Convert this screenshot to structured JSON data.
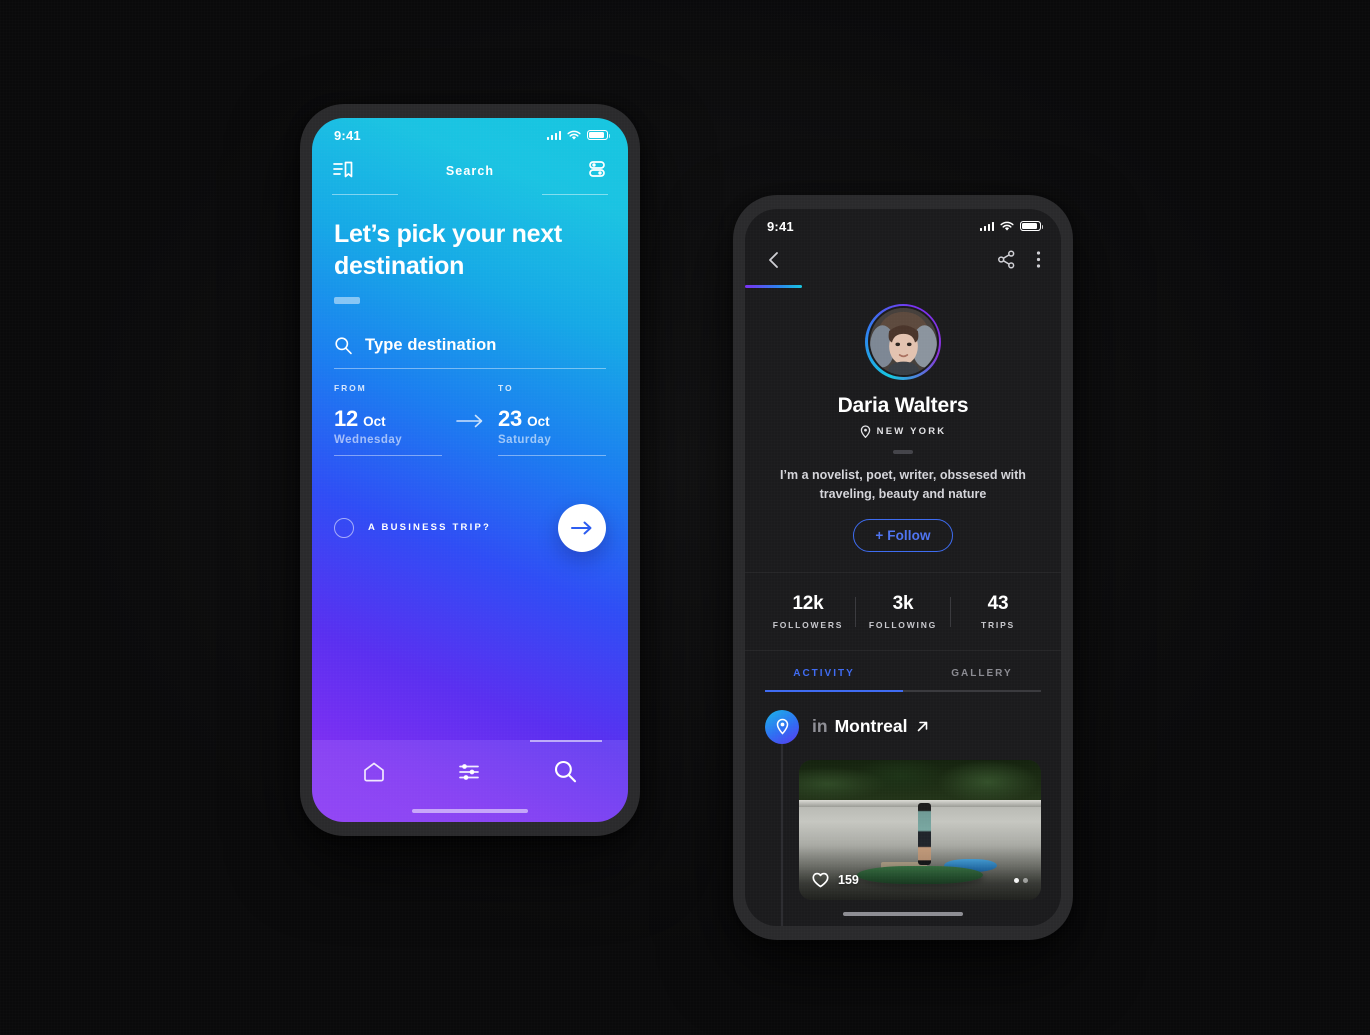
{
  "background": {
    "color": "#0b0b0c"
  },
  "left_phone": {
    "status_bar": {
      "time": "9:41",
      "signal_icon": "cellular-bars-icon",
      "wifi_icon": "wifi-icon",
      "battery_icon": "battery-icon"
    },
    "header": {
      "left_icon": "bookmark-list-icon",
      "title": "Search",
      "right_icon": "filter-toggle-icon"
    },
    "hero": {
      "title": "Let’s pick your next destination"
    },
    "search": {
      "icon": "search-icon",
      "placeholder": "Type destination",
      "value": ""
    },
    "dates": {
      "from": {
        "label": "FROM",
        "day": "12",
        "month": "Oct",
        "weekday": "Wednesday"
      },
      "arrow_icon": "arrow-right-icon",
      "to": {
        "label": "TO",
        "day": "23",
        "month": "Oct",
        "weekday": "Saturday"
      }
    },
    "business": {
      "checkbox_icon": "radio-unchecked-icon",
      "label": "A BUSINESS TRIP?",
      "checked": false
    },
    "submit": {
      "icon": "arrow-right-icon"
    },
    "tabbar": {
      "items": [
        {
          "name": "home",
          "icon": "home-icon",
          "active": false
        },
        {
          "name": "filters",
          "icon": "sliders-icon",
          "active": false
        },
        {
          "name": "search",
          "icon": "search-icon",
          "active": true
        }
      ]
    },
    "theme": {
      "gradient_from": "#16c6e0",
      "gradient_mid": "#2f4df5",
      "gradient_to": "#8733f3"
    }
  },
  "right_phone": {
    "status_bar": {
      "time": "9:41",
      "signal_icon": "cellular-bars-icon",
      "wifi_icon": "wifi-icon",
      "battery_icon": "battery-icon"
    },
    "header": {
      "back_icon": "chevron-left-icon",
      "share_icon": "share-icon",
      "more_icon": "more-vertical-icon"
    },
    "progress": {
      "percent": 18
    },
    "profile": {
      "avatar_icon": "user-avatar",
      "name": "Daria Walters",
      "location_icon": "map-pin-icon",
      "location": "NEW YORK",
      "bio": "I’m a novelist, poet, writer, obssesed with traveling, beauty and nature",
      "follow_label": "+ Follow",
      "follow_color": "#4f74f2"
    },
    "stats": [
      {
        "value": "12k",
        "label": "FOLLOWERS"
      },
      {
        "value": "3k",
        "label": "FOLLOWING"
      },
      {
        "value": "43",
        "label": "TRIPS"
      }
    ],
    "tabs": [
      {
        "label": "ACTIVITY",
        "active": true
      },
      {
        "label": "GALLERY",
        "active": false
      }
    ],
    "feed": {
      "pin_icon": "map-pin-icon",
      "prefix": "in",
      "place": "Montreal",
      "external_icon": "arrow-up-right-icon",
      "post": {
        "like_icon": "heart-icon",
        "likes": "159",
        "carousel_dots": 2
      }
    },
    "theme": {
      "accent": "#3f6bf2",
      "surface": "#1b1b1d"
    }
  }
}
